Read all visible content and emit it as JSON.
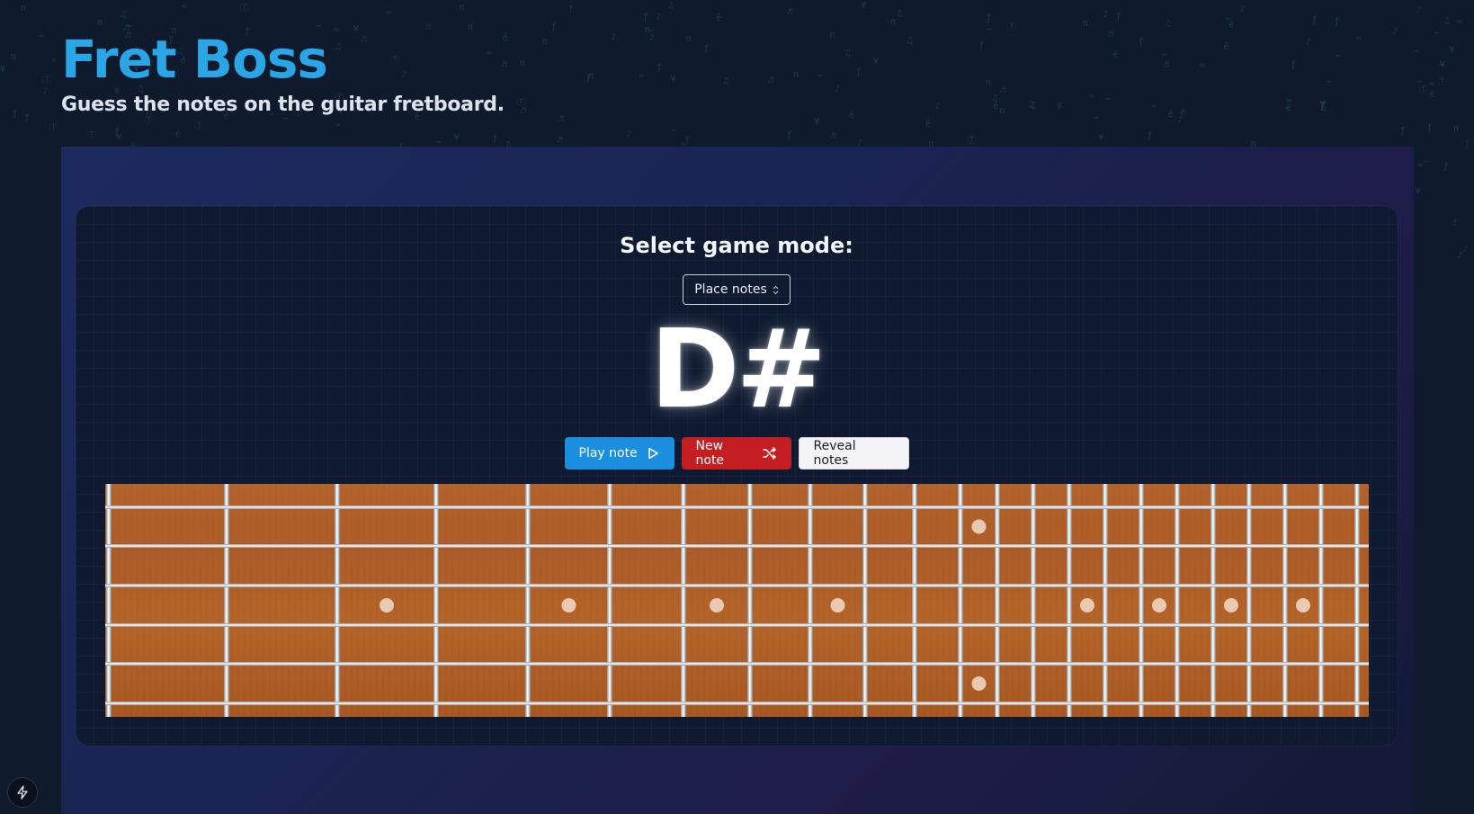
{
  "app": {
    "title": "Fret Boss",
    "subtitle": "Guess the notes on the guitar fretboard."
  },
  "game": {
    "mode_heading": "Select game mode:",
    "mode_selected": "Place notes",
    "current_note": "D#"
  },
  "buttons": {
    "play_label": "Play note",
    "new_label": "New note",
    "reveal_label": "Reveal notes"
  },
  "icons": {
    "play": "play-icon",
    "shuffle": "shuffle-icon",
    "select_chevron": "chevron-up-down-icon",
    "corner": "bolt-icon"
  },
  "colors": {
    "title": "#2aa6e6",
    "play_button": "#1a8fe0",
    "new_button": "#c41e22",
    "reveal_button": "#f4f4f6",
    "fretboard_wood": "#b4622a",
    "inlay": "#e8c9b4"
  },
  "fretboard": {
    "strings": 6,
    "frets": 24,
    "inlays": [
      {
        "fret": 3,
        "string": 3
      },
      {
        "fret": 5,
        "string": 3
      },
      {
        "fret": 7,
        "string": 3
      },
      {
        "fret": 9,
        "string": 3
      },
      {
        "fret": 12,
        "string": 1
      },
      {
        "fret": 12,
        "string": 5
      },
      {
        "fret": 15,
        "string": 3
      },
      {
        "fret": 17,
        "string": 3
      },
      {
        "fret": 19,
        "string": 3
      },
      {
        "fret": 21,
        "string": 3
      }
    ]
  }
}
